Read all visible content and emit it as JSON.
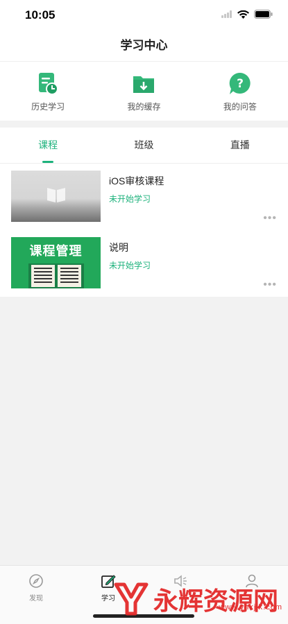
{
  "status_bar": {
    "time": "10:05"
  },
  "nav": {
    "title": "学习中心"
  },
  "quick_actions": [
    {
      "label": "历史学习",
      "icon": "history-document-icon"
    },
    {
      "label": "我的缓存",
      "icon": "download-folder-icon"
    },
    {
      "label": "我的问答",
      "icon": "question-chat-icon"
    }
  ],
  "tabs": [
    {
      "label": "课程",
      "active": true
    },
    {
      "label": "班级",
      "active": false
    },
    {
      "label": "直播",
      "active": false
    }
  ],
  "courses": [
    {
      "title": "iOS审核课程",
      "status": "未开始学习",
      "more": "•••",
      "thumb": "book-gray-thumbnail"
    },
    {
      "title": "说明",
      "status": "未开始学习",
      "more": "•••",
      "thumb_title": "课程管理"
    }
  ],
  "tab_bar": [
    {
      "label": "发现",
      "icon": "compass-icon",
      "active": false
    },
    {
      "label": "学习",
      "icon": "edit-note-icon",
      "active": true
    },
    {
      "label": "",
      "icon": "speaker-icon",
      "active": false
    },
    {
      "label": "",
      "icon": "person-icon",
      "active": false
    }
  ],
  "watermark": {
    "text": "永辉资源网",
    "url": "www.yhkjjk.com"
  },
  "colors": {
    "accent": "#1db27c",
    "background": "#f2f2f2",
    "watermark": "#e32a2a"
  }
}
